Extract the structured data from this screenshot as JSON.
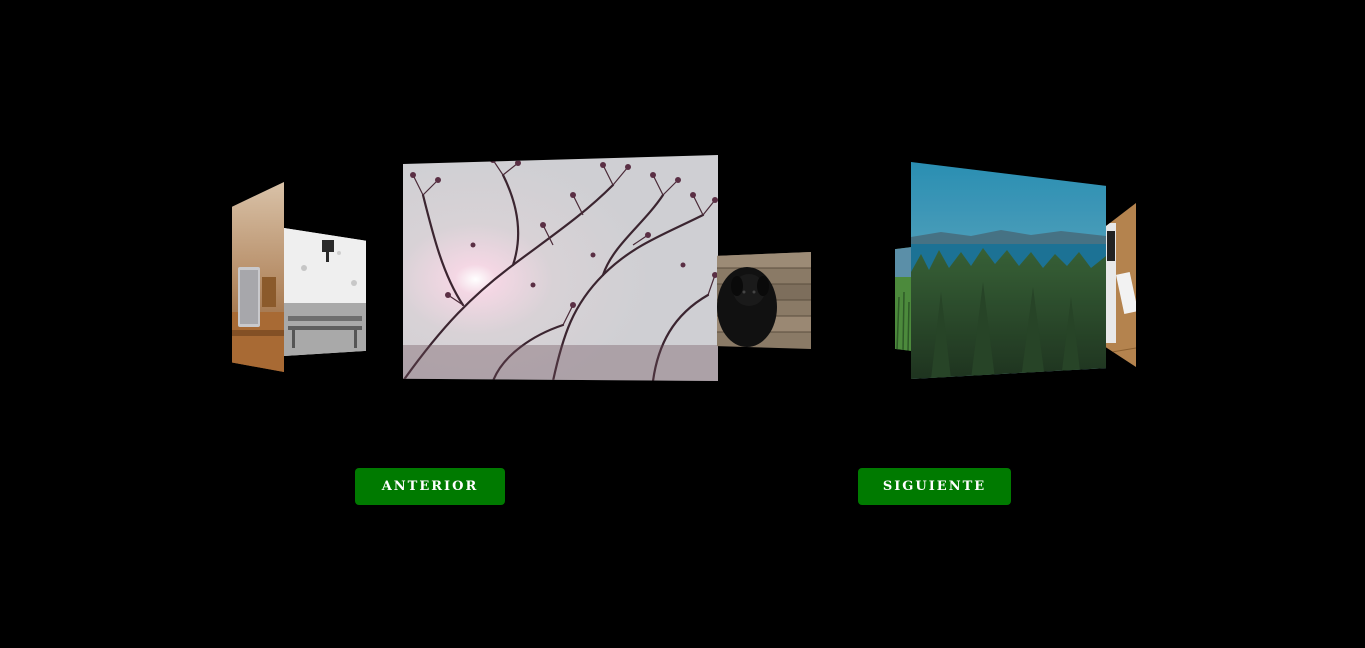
{
  "carousel": {
    "slides": [
      {
        "name": "laptop-desk-photo"
      },
      {
        "name": "bench-wall-photo"
      },
      {
        "name": "branches-sun-photo"
      },
      {
        "name": "black-dog-photo"
      },
      {
        "name": "grass-photo"
      },
      {
        "name": "forest-sea-photo"
      },
      {
        "name": "desk-phone-photo"
      }
    ]
  },
  "controls": {
    "prev_label": "ANTERIOR",
    "next_label": "SIGUIENTE"
  },
  "colors": {
    "background": "#000000",
    "button": "#007a00",
    "button_text": "#ffffff"
  }
}
